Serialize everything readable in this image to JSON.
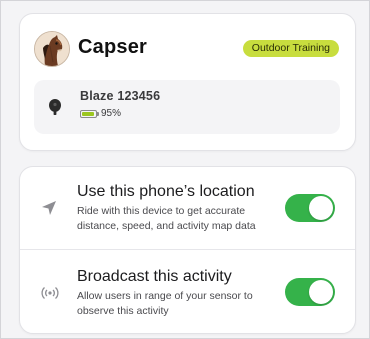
{
  "rider": {
    "name": "Capser",
    "badge": "Outdoor Training",
    "avatar_icon": "horse-avatar"
  },
  "device": {
    "name": "Blaze 123456",
    "battery_label": "95%",
    "battery_level": 0.95,
    "icon": "sensor-icon"
  },
  "settings": [
    {
      "title": "Use this phone’s location",
      "description": "Ride with this device to get accurate distance, speed, and activity map data",
      "icon": "location-arrow-icon",
      "enabled": true
    },
    {
      "title": "Broadcast this activity",
      "description": "Allow users in range of your sensor to observe this activity",
      "icon": "broadcast-icon",
      "enabled": true
    }
  ],
  "colors": {
    "badge": "#c8dd3e",
    "toggle_on": "#35b24a",
    "battery_fill": "#9bc61f"
  }
}
